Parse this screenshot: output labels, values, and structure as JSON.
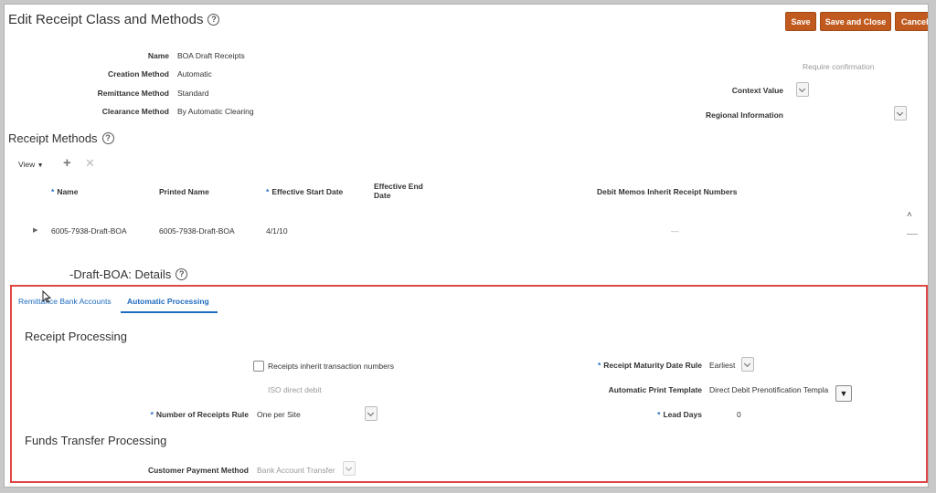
{
  "header": {
    "title": "Edit Receipt Class and Methods",
    "buttons": {
      "save": "Save",
      "save_close": "Save and Close",
      "cancel": "Cancel"
    }
  },
  "summary": {
    "name_label": "Name",
    "name_value": "BOA Draft Receipts",
    "creation_label": "Creation Method",
    "creation_value": "Automatic",
    "remittance_label": "Remittance Method",
    "remittance_value": "Standard",
    "clearance_label": "Clearance Method",
    "clearance_value": "By Automatic Clearing",
    "require_confirmation": "Require confirmation",
    "context_value_label": "Context Value",
    "regional_info_label": "Regional Information"
  },
  "receipt_methods": {
    "title": "Receipt Methods",
    "view_label": "View",
    "columns": {
      "name": "Name",
      "printed_name": "Printed Name",
      "start_date": "Effective Start Date",
      "end_date_1": "Effective End",
      "end_date_2": "Date",
      "debit_memos": "Debit Memos Inherit Receipt Numbers"
    },
    "rows": [
      {
        "name": "6005-7938-Draft-BOA",
        "printed_name": "6005-7938-Draft-BOA",
        "start_date": "4/1/10",
        "debit_memos": "—"
      }
    ]
  },
  "details": {
    "title": "-Draft-BOA: Details",
    "tabs": {
      "remittance": "Remittance Bank Accounts",
      "automatic": "Automatic Processing"
    },
    "receipt_processing": {
      "title": "Receipt Processing",
      "inherit_label": "Receipts inherit transaction numbers",
      "iso_label": "ISO direct debit",
      "num_receipts_label": "Number of Receipts Rule",
      "num_receipts_value": "One per Site",
      "maturity_label": "Receipt Maturity Date Rule",
      "maturity_value": "Earliest",
      "print_template_label": "Automatic Print Template",
      "print_template_value": "Direct Debit Prenotification Templa",
      "lead_days_label": "Lead Days",
      "lead_days_value": "0"
    },
    "funds_transfer": {
      "title": "Funds Transfer Processing",
      "payment_method_label": "Customer Payment Method",
      "payment_method_value": "Bank Account Transfer"
    }
  },
  "colors": {
    "accent": "#c15a1e",
    "link": "#1e6bbf",
    "highlight": "#e04646"
  }
}
